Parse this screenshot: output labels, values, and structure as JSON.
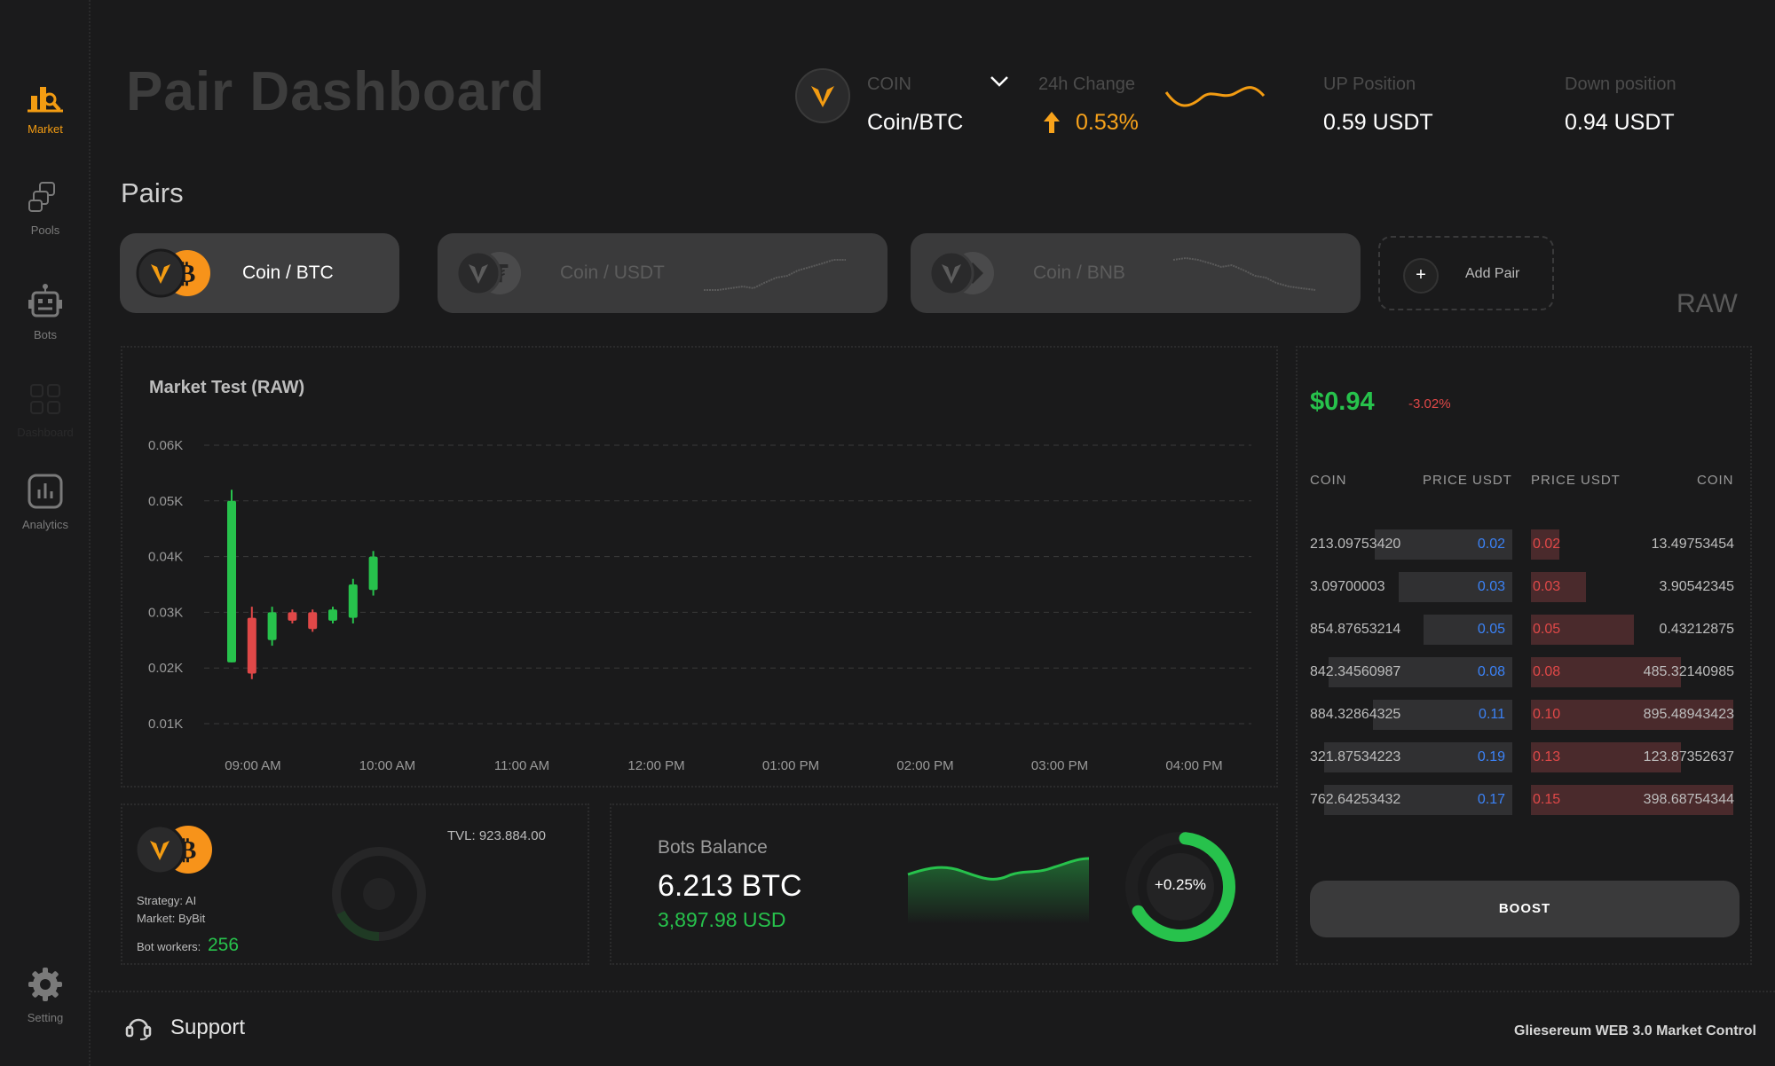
{
  "sidebar": {
    "items": [
      {
        "label": "Market",
        "icon": "market-chart-icon"
      },
      {
        "label": "Pools",
        "icon": "pools-icon"
      },
      {
        "label": "Bots",
        "icon": "bot-icon"
      },
      {
        "label": "Dashboard",
        "icon": "dashboard-grid-icon"
      },
      {
        "label": "Analytics",
        "icon": "analytics-icon"
      },
      {
        "label": "Setting",
        "icon": "gear-icon"
      }
    ],
    "accent": "#f39c12"
  },
  "header": {
    "title": "Pair Dashboard",
    "coin_label": "COIN",
    "coin_value": "Coin/BTC",
    "change_label": "24h Change",
    "change_value": "0.53%",
    "up_label": "UP Position",
    "up_value": "0.59 USDT",
    "down_label": "Down position",
    "down_value": "0.94 USDT"
  },
  "pairs": {
    "title": "Pairs",
    "items": [
      {
        "label": "Coin / BTC"
      },
      {
        "label": "Coin / USDT"
      },
      {
        "label": "Coin / BNB"
      }
    ],
    "add_label": "Add Pair",
    "raw_label": "RAW"
  },
  "chart": {
    "title": "Market Test (RAW)"
  },
  "chart_data": {
    "type": "candlestick",
    "title": "Market Test (RAW)",
    "y_ticks": [
      "0.06K",
      "0.05K",
      "0.04K",
      "0.03K",
      "0.02K",
      "0.01K"
    ],
    "x_ticks": [
      "09:00 AM",
      "10:00 AM",
      "11:00 AM",
      "12:00 PM",
      "01:00 PM",
      "02:00 PM",
      "03:00 PM",
      "04:00 PM"
    ],
    "ylim": [
      0.01,
      0.06
    ],
    "grid": true,
    "candles": [
      {
        "open": 0.021,
        "close": 0.05,
        "high": 0.052,
        "low": 0.021,
        "up": true
      },
      {
        "open": 0.029,
        "close": 0.019,
        "high": 0.031,
        "low": 0.018,
        "up": false
      },
      {
        "open": 0.025,
        "close": 0.03,
        "high": 0.031,
        "low": 0.024,
        "up": true
      },
      {
        "open": 0.03,
        "close": 0.0285,
        "high": 0.0305,
        "low": 0.028,
        "up": false
      },
      {
        "open": 0.03,
        "close": 0.027,
        "high": 0.0305,
        "low": 0.0265,
        "up": false
      },
      {
        "open": 0.0285,
        "close": 0.0305,
        "high": 0.031,
        "low": 0.028,
        "up": true
      },
      {
        "open": 0.029,
        "close": 0.035,
        "high": 0.036,
        "low": 0.028,
        "up": true
      },
      {
        "open": 0.034,
        "close": 0.04,
        "high": 0.041,
        "low": 0.033,
        "up": true
      }
    ],
    "up_color": "#27c24c",
    "down_color": "#e04848"
  },
  "pool": {
    "tvl": "TVL: 923.884.00",
    "strategy": "Strategy: AI",
    "market": "Market: ByBit",
    "workers_label": "Bot workers:",
    "workers_value": "256"
  },
  "bots": {
    "label": "Bots Balance",
    "btc": "6.213 BTC",
    "usd": "3,897.98 USD",
    "gauge_text": "+0.25%",
    "gauge_level": 0.65
  },
  "orderbook": {
    "price": "$0.94",
    "change": "-3.02%",
    "headers": [
      "COIN",
      "PRICE USDT",
      "PRICE USDT",
      "COIN"
    ],
    "rows": [
      {
        "coin_l": "213.09753420",
        "price_l": "0.02",
        "price_r": "0.02",
        "coin_r": "13.49753454",
        "depth_l": 0.68,
        "depth_r": 0.14
      },
      {
        "coin_l": "3.09700003",
        "price_l": "0.03",
        "price_r": "0.03",
        "coin_r": "3.90542345",
        "depth_l": 0.56,
        "depth_r": 0.27
      },
      {
        "coin_l": "854.87653214",
        "price_l": "0.05",
        "price_r": "0.05",
        "coin_r": "0.43212875",
        "depth_l": 0.44,
        "depth_r": 0.51
      },
      {
        "coin_l": "842.34560987",
        "price_l": "0.08",
        "price_r": "0.08",
        "coin_r": "485.32140985",
        "depth_l": 0.91,
        "depth_r": 0.74
      },
      {
        "coin_l": "884.32864325",
        "price_l": "0.11",
        "price_r": "0.10",
        "coin_r": "895.48943423",
        "depth_l": 0.69,
        "depth_r": 1.0
      },
      {
        "coin_l": "321.87534223",
        "price_l": "0.19",
        "price_r": "0.13",
        "coin_r": "123.87352637",
        "depth_l": 0.93,
        "depth_r": 0.74
      },
      {
        "coin_l": "762.64253432",
        "price_l": "0.17",
        "price_r": "0.15",
        "coin_r": "398.68754344",
        "depth_l": 0.93,
        "depth_r": 1.0
      }
    ],
    "boost_label": "BOOST"
  },
  "footer": {
    "support": "Support",
    "brand": "Gliesereum WEB 3.0 Market Control"
  }
}
